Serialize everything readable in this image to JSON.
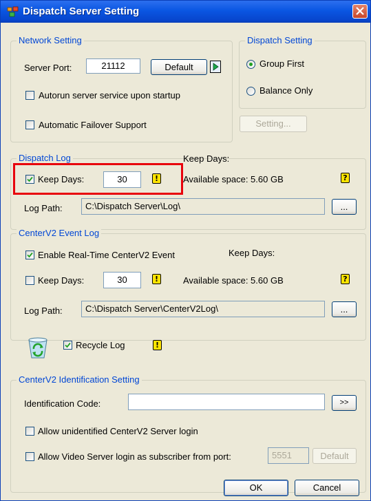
{
  "window": {
    "title": "Dispatch Server Setting"
  },
  "network": {
    "legend": "Network Setting",
    "server_port_label": "Server Port:",
    "server_port_value": "21112",
    "default_label": "Default",
    "autorun_label": "Autorun server service upon startup",
    "failover_label": "Automatic Failover Support",
    "setting_label": "Setting..."
  },
  "dispatch": {
    "legend": "Dispatch Setting",
    "group_first_label": "Group First",
    "balance_only_label": "Balance Only",
    "selected": "Group First"
  },
  "dispatch_log": {
    "legend": "Dispatch Log",
    "keep_days_header": "Keep Days:",
    "keep_days_label": "Keep Days:",
    "keep_days_checked": true,
    "keep_days_value": "30",
    "available_space": "Available space: 5.60 GB",
    "log_path_label": "Log Path:",
    "log_path_value": "C:\\Dispatch Server\\Log\\",
    "browse_label": "..."
  },
  "event_log": {
    "legend": "CenterV2 Event Log",
    "enable_label": "Enable Real-Time CenterV2 Event",
    "enable_checked": true,
    "keep_days_header": "Keep Days:",
    "keep_days_label": "Keep Days:",
    "keep_days_checked": false,
    "keep_days_value": "30",
    "available_space": "Available space: 5.60 GB",
    "log_path_label": "Log Path:",
    "log_path_value": "C:\\Dispatch Server\\CenterV2Log\\",
    "browse_label": "..."
  },
  "recycle": {
    "label": "Recycle Log",
    "checked": true
  },
  "identification": {
    "legend": "CenterV2 Identification Setting",
    "code_label": "Identification Code:",
    "code_value": "",
    "arrow_label": ">>",
    "allow_unidentified_label": "Allow unidentified CenterV2 Server  login",
    "allow_video_label": "Allow Video Server login as subscriber from port:",
    "port_value": "5551",
    "default_label": "Default"
  },
  "footer": {
    "ok_label": "OK",
    "cancel_label": "Cancel"
  },
  "icons": {
    "warn_glyph": "!",
    "help_glyph": "?"
  },
  "colors": {
    "legend": "#0046d5",
    "highlight": "#e8000b",
    "title_bar": "#0a56e2"
  }
}
